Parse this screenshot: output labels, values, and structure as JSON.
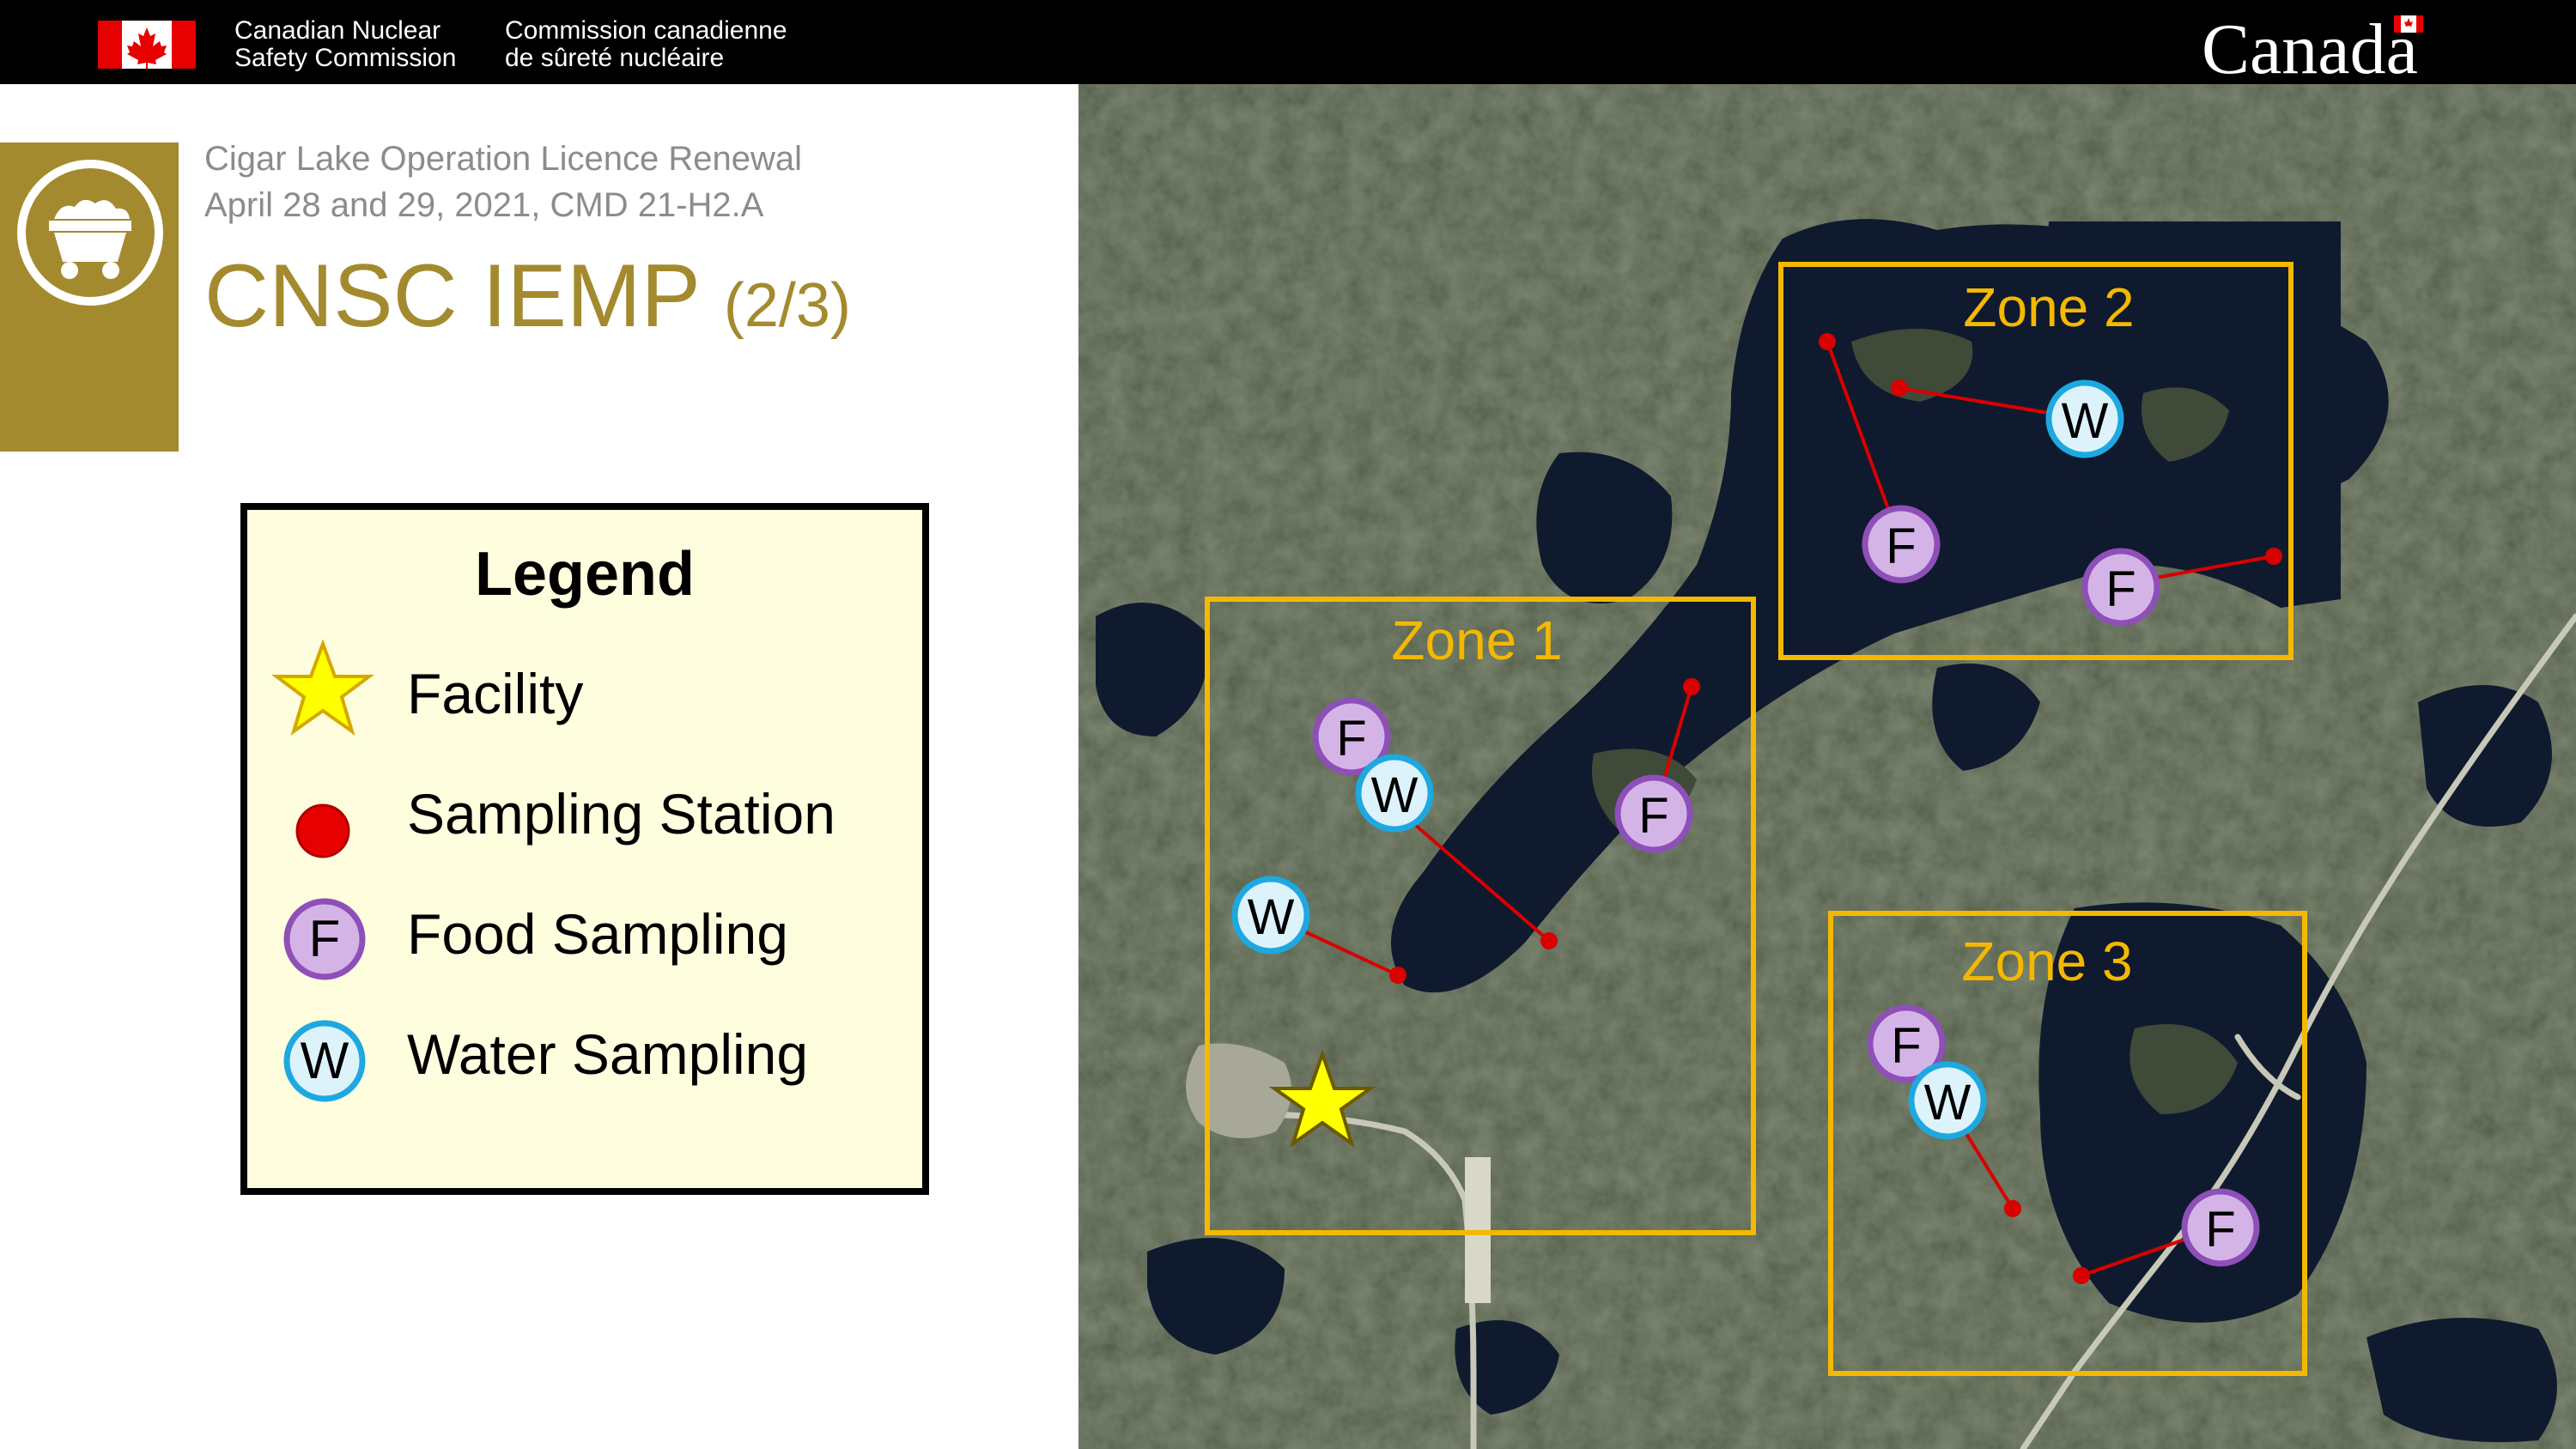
{
  "header": {
    "agency_en_line1": "Canadian Nuclear",
    "agency_en_line2": "Safety Commission",
    "agency_fr_line1": "Commission canadienne",
    "agency_fr_line2": "de sûreté nucléaire",
    "wordmark": "Canada"
  },
  "slide": {
    "subtitle_line1": "Cigar Lake Operation Licence Renewal",
    "subtitle_line2": "April 28 and 29, 2021, CMD 21-H2.A",
    "title_main": "CNSC IEMP",
    "title_suffix": "(2/3)"
  },
  "legend": {
    "title": "Legend",
    "facility": "Facility",
    "sampling_station": "Sampling Station",
    "food_sampling": "Food Sampling",
    "food_letter": "F",
    "water_sampling": "Water Sampling",
    "water_letter": "W"
  },
  "map": {
    "zones": {
      "zone1": "Zone 1",
      "zone2": "Zone 2",
      "zone3": "Zone 3"
    },
    "marker_food": "F",
    "marker_water": "W"
  },
  "colors": {
    "brand_gold": "#a48a2e",
    "zone_border": "#f5b800",
    "food_fill": "#d4b4e6",
    "food_border": "#8e4fb8",
    "water_fill": "#ddf3fc",
    "water_border": "#1ea8e0",
    "station_red": "#d90000",
    "legend_bg": "#fefedf"
  }
}
